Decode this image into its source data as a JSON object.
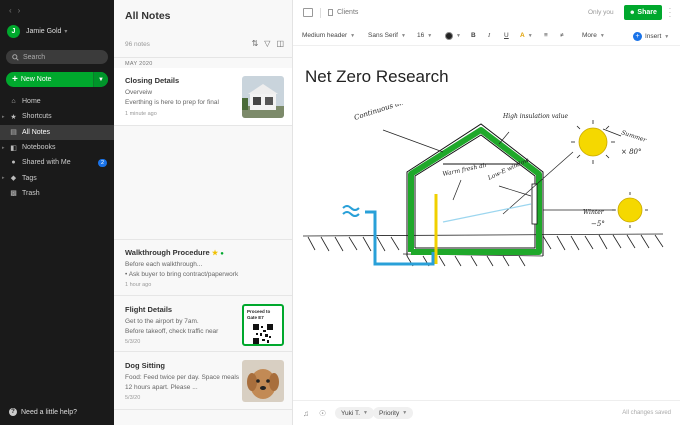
{
  "sidebar": {
    "user_initial": "J",
    "user_name": "Jamie Gold",
    "search_placeholder": "Search",
    "new_note_label": "New Note",
    "items": [
      {
        "label": "Home",
        "icon": "home-icon"
      },
      {
        "label": "Shortcuts",
        "icon": "star-icon"
      },
      {
        "label": "All Notes",
        "icon": "note-icon",
        "active": true
      },
      {
        "label": "Notebooks",
        "icon": "notebook-icon"
      },
      {
        "label": "Shared with Me",
        "icon": "people-icon",
        "badge": "2"
      },
      {
        "label": "Tags",
        "icon": "tag-icon"
      },
      {
        "label": "Trash",
        "icon": "trash-icon"
      }
    ],
    "help_label": "Need a little help?"
  },
  "notes_list": {
    "title": "All Notes",
    "count": "96 notes",
    "section": "MAY 2020",
    "notes": [
      {
        "title": "Closing Details",
        "snippet": "Overveiw\nEverthing is here to prep for final",
        "date": "1 minute ago"
      },
      {
        "title": "Walkthrough Procedure",
        "snippet": "Before each walkthrough...\n•  Ask buyer to bring contract/paperwork",
        "date": "1 hour ago"
      },
      {
        "title": "Flight Details",
        "snippet": "Get to the airport by 7am.\nBefore takeoff, check traffic near",
        "date": "5/3/20",
        "ticket_text": "Proceed to Gate E7"
      },
      {
        "title": "Dog Sitting",
        "snippet": "Food: Feed twice per day. Space meals 12 hours apart. Please ...",
        "date": "5/3/20"
      }
    ]
  },
  "editor": {
    "notebook": "Clients",
    "visibility": "Only you",
    "share_label": "Share",
    "toolbar": {
      "style": "Medium header",
      "font": "Sans Serif",
      "size": "16",
      "bold": "B",
      "italic": "I",
      "underline": "U",
      "highlight": "A",
      "more": "More",
      "insert": "Insert"
    },
    "heading": "Net Zero Research",
    "sketch_labels": {
      "barrier": "Continuous air barrier",
      "insulation": "High insulation value",
      "warm": "Warm fresh air",
      "window": "Low-E window",
      "summer": "Summer",
      "summer_temp": "× 80°",
      "winter": "Winter",
      "winter_temp": "−5°"
    },
    "footer": {
      "owner": "Yuki T.",
      "priority": "Priority",
      "status": "All changes saved"
    }
  },
  "colors": {
    "brand_green": "#00a82d",
    "badge_blue": "#1a73e8",
    "sidebar_bg": "#1a1a1a"
  }
}
